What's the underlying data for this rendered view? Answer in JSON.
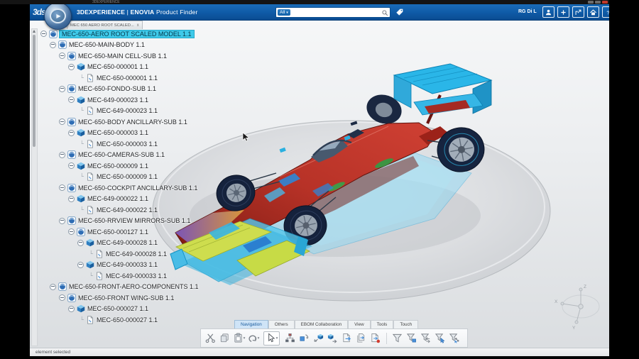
{
  "os": {
    "title": "3DEXPERIENCE"
  },
  "header": {
    "logo": "3ds",
    "brand": "3DEXPERIENCE",
    "separator": "|",
    "app": "ENOVIA",
    "module": "Product Finder",
    "search": {
      "scope": "All",
      "value": "",
      "placeholder": ""
    },
    "user": "RG Di L",
    "icons": [
      "user-avatar-icon",
      "add-icon",
      "share-icon",
      "home-icon",
      "help-icon"
    ]
  },
  "doc_tab": {
    "label": "MEC 650 AERO ROOT SCALED...",
    "close": "x"
  },
  "tree": {
    "rows": [
      {
        "level": 0,
        "label": "MEC-650-AERO ROOT SCALED MODEL 1.1",
        "icon": "product",
        "selected": true,
        "expandable": true
      },
      {
        "level": 1,
        "label": "MEC-650-MAIN-BODY 1.1",
        "icon": "product",
        "selected": false,
        "expandable": true
      },
      {
        "level": 2,
        "label": "MEC-650-MAIN CELL-SUB 1.1",
        "icon": "product",
        "selected": false,
        "expandable": true
      },
      {
        "level": 3,
        "label": "MEC-650-000001 1.1",
        "icon": "part",
        "selected": false,
        "expandable": true
      },
      {
        "level": 4,
        "label": "MEC-650-000001 1.1",
        "icon": "document",
        "selected": false,
        "expandable": false
      },
      {
        "level": 2,
        "label": "MEC-650-FONDO-SUB 1.1",
        "icon": "product",
        "selected": false,
        "expandable": true
      },
      {
        "level": 3,
        "label": "MEC-649-000023 1.1",
        "icon": "part",
        "selected": false,
        "expandable": true
      },
      {
        "level": 4,
        "label": "MEC-649-000023 1.1",
        "icon": "document",
        "selected": false,
        "expandable": false
      },
      {
        "level": 2,
        "label": "MEC-650-BODY ANCILLARY-SUB 1.1",
        "icon": "product",
        "selected": false,
        "expandable": true
      },
      {
        "level": 3,
        "label": "MEC-650-000003 1.1",
        "icon": "part",
        "selected": false,
        "expandable": true
      },
      {
        "level": 4,
        "label": "MEC-650-000003 1.1",
        "icon": "document",
        "selected": false,
        "expandable": false
      },
      {
        "level": 2,
        "label": "MEC-650-CAMERAS-SUB 1.1",
        "icon": "product",
        "selected": false,
        "expandable": true
      },
      {
        "level": 3,
        "label": "MEC-650-000009 1.1",
        "icon": "part",
        "selected": false,
        "expandable": true
      },
      {
        "level": 4,
        "label": "MEC-650-000009 1.1",
        "icon": "document",
        "selected": false,
        "expandable": false
      },
      {
        "level": 2,
        "label": "MEC-650-COCKPIT ANCILLARY-SUB 1.1",
        "icon": "product",
        "selected": false,
        "expandable": true
      },
      {
        "level": 3,
        "label": "MEC-649-000022 1.1",
        "icon": "part",
        "selected": false,
        "expandable": true
      },
      {
        "level": 4,
        "label": "MEC-649-000022 1.1",
        "icon": "document",
        "selected": false,
        "expandable": false
      },
      {
        "level": 2,
        "label": "MEC-650-RRVIEW MIRRORS-SUB 1.1",
        "icon": "product",
        "selected": false,
        "expandable": true
      },
      {
        "level": 3,
        "label": "MEC-650-000127 1.1",
        "icon": "product",
        "selected": false,
        "expandable": true
      },
      {
        "level": 4,
        "label": "MEC-649-000028 1.1",
        "icon": "part",
        "selected": false,
        "expandable": true
      },
      {
        "level": 5,
        "label": "MEC-649-000028 1.1",
        "icon": "document",
        "selected": false,
        "expandable": false
      },
      {
        "level": 4,
        "label": "MEC-649-000033 1.1",
        "icon": "part",
        "selected": false,
        "expandable": true
      },
      {
        "level": 5,
        "label": "MEC-649-000033 1.1",
        "icon": "document",
        "selected": false,
        "expandable": false
      },
      {
        "level": 1,
        "label": "MEC-650-FRONT-AERO-COMPONENTS 1.1",
        "icon": "product",
        "selected": false,
        "expandable": true
      },
      {
        "level": 2,
        "label": "MEC-650-FRONT WING-SUB 1.1",
        "icon": "product",
        "selected": false,
        "expandable": true
      },
      {
        "level": 3,
        "label": "MEC-650-000027 1.1",
        "icon": "part",
        "selected": false,
        "expandable": true
      },
      {
        "level": 4,
        "label": "MEC-650-000027 1.1",
        "icon": "document",
        "selected": false,
        "expandable": false
      }
    ]
  },
  "toolbar": {
    "tabs": [
      {
        "label": "Navigation",
        "selected": true
      },
      {
        "label": "Others",
        "selected": false
      },
      {
        "label": "EBOM Collaboration",
        "selected": false
      },
      {
        "label": "View",
        "selected": false
      },
      {
        "label": "Tools",
        "selected": false
      },
      {
        "label": "Touch",
        "selected": false
      }
    ],
    "groups": [
      {
        "style": "plain",
        "icons": [
          {
            "name": "cut"
          },
          {
            "name": "copy"
          },
          {
            "name": "paste",
            "caret": true
          },
          {
            "name": "undo",
            "caret": true
          }
        ]
      },
      {
        "style": "boxed",
        "icons": [
          {
            "name": "select-cursor",
            "caret": true
          }
        ]
      },
      {
        "style": "plain",
        "icons": [
          {
            "name": "tree-structure"
          },
          {
            "name": "replace-version"
          },
          {
            "name": "insert-product"
          },
          {
            "name": "import-part"
          },
          {
            "name": "export-page"
          },
          {
            "name": "duplicate-page"
          },
          {
            "name": "export-page-alert"
          }
        ]
      },
      {
        "style": "divided",
        "icons": [
          {
            "name": "filter"
          },
          {
            "name": "filter-box"
          },
          {
            "name": "filter-refresh"
          },
          {
            "name": "filter-select"
          },
          {
            "name": "filter-graph"
          }
        ]
      }
    ]
  },
  "status": {
    "text": "element selected"
  },
  "viewport": {
    "axis_labels": {
      "x": "X",
      "y": "Y",
      "z": "Z"
    }
  },
  "colors": {
    "header_blue": "#0f5aa6",
    "selection_cyan": "#3ec9e9",
    "car_red": "#b03026",
    "wing_cyan": "#29b7e8",
    "flap_yellow": "#cedd4e"
  }
}
